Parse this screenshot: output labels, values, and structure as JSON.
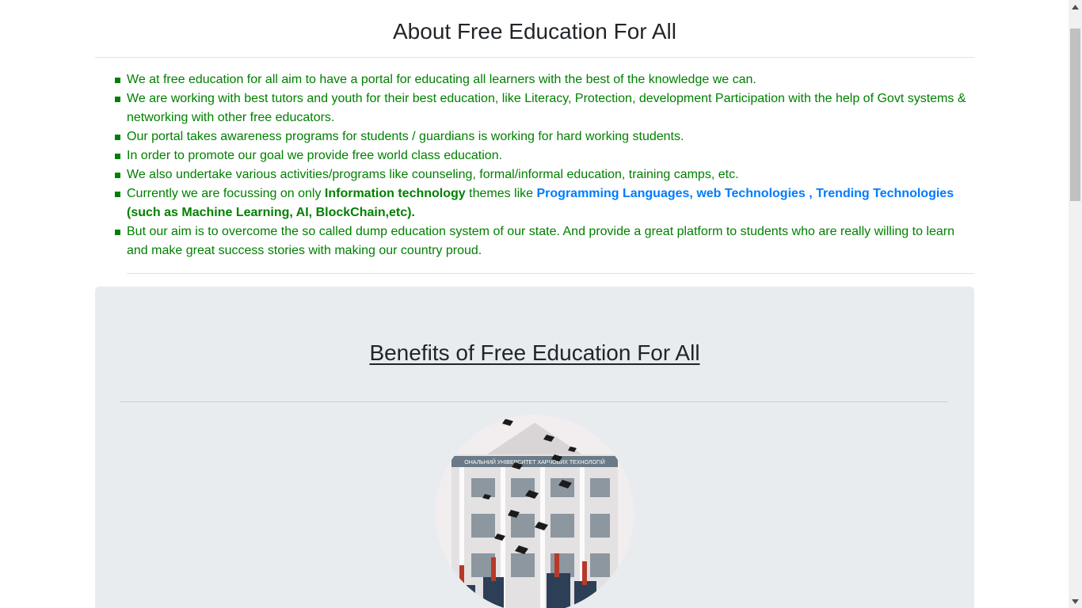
{
  "about": {
    "title": "About Free Education For All",
    "items": [
      {
        "text": "We at free education for all aim to have a portal for educating all learners with the best of the knowledge we can."
      },
      {
        "text": "We are working with best tutors and youth for their best education, like Literacy, Protection, development Participation with the help of Govt systems & networking with other free educators."
      },
      {
        "text": "Our portal takes awareness programs for students / guardians is working for hard working students."
      },
      {
        "text": "In order to promote our goal we provide free world class education."
      },
      {
        "text": "We also undertake various activities/programs like counseling, formal/informal education, training camps, etc."
      },
      {
        "prefix": "Currently we are focussing on only ",
        "highlight": "Information technology",
        "middle": " themes like ",
        "topics": "Programming Languages, web Technologies , Trending Technologies",
        "suffix": " (such as Machine Learning, AI, BlockChain,etc)."
      },
      {
        "text": "But our aim is to overcome the so called dump education system of our state. And provide a great platform to students who are really willing to learn and make great success stories with making our country proud."
      }
    ]
  },
  "benefits": {
    "title": "Benefits of Free Education For All",
    "image_subject": "graduates-throwing-caps-photo"
  },
  "colors": {
    "list_text": "#008000",
    "link_blue": "#007bff",
    "jumbotron_bg": "#e9ecef"
  }
}
